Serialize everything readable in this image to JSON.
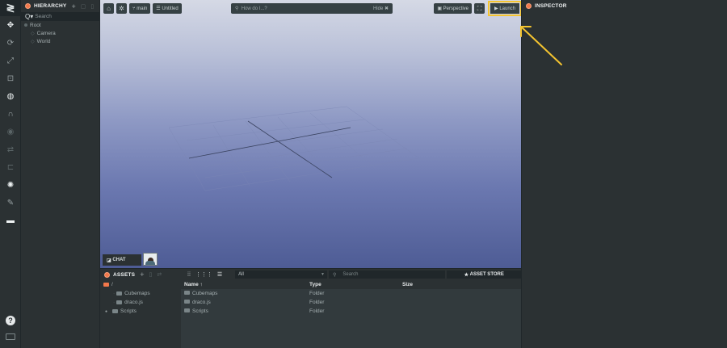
{
  "toolbar": {
    "logo": "≷",
    "tools": [
      "move-icon",
      "rotate-icon",
      "scale-icon",
      "resize-icon",
      "world-icon",
      "snap-icon",
      "eye-icon",
      "translate-local-icon",
      "link-icon",
      "bake-light-icon",
      "edit-icon",
      "layout-icon"
    ],
    "help": "?"
  },
  "hierarchy": {
    "title": "HIERARCHY",
    "search_placeholder": "Search",
    "items": [
      {
        "label": "Root"
      },
      {
        "label": "Camera"
      },
      {
        "label": "World"
      }
    ]
  },
  "viewport_toolbar": {
    "branch": "main",
    "scene": "Untitled",
    "search_placeholder": "How do I...?",
    "hide_label": "Hide",
    "perspective_label": "Perspective",
    "launch_label": "Launch"
  },
  "chat": {
    "label": "CHAT"
  },
  "assets": {
    "title": "ASSETS",
    "root_label": "/",
    "tree": [
      {
        "label": "Cubemaps"
      },
      {
        "label": "draco.js"
      },
      {
        "label": "Scripts"
      }
    ],
    "filter_value": "All",
    "search_placeholder": "Search",
    "store_label": "ASSET STORE",
    "columns": [
      "Name ↑",
      "Type",
      "Size"
    ],
    "rows": [
      {
        "name": "Cubemaps",
        "type": "Folder",
        "size": ""
      },
      {
        "name": "draco.js",
        "type": "Folder",
        "size": ""
      },
      {
        "name": "Scripts",
        "type": "Folder",
        "size": ""
      }
    ]
  },
  "inspector": {
    "title": "INSPECTOR"
  },
  "colors": {
    "accent_orange": "#f2784b",
    "highlight_yellow": "#f4c430",
    "panel_bg": "#2b3133"
  }
}
